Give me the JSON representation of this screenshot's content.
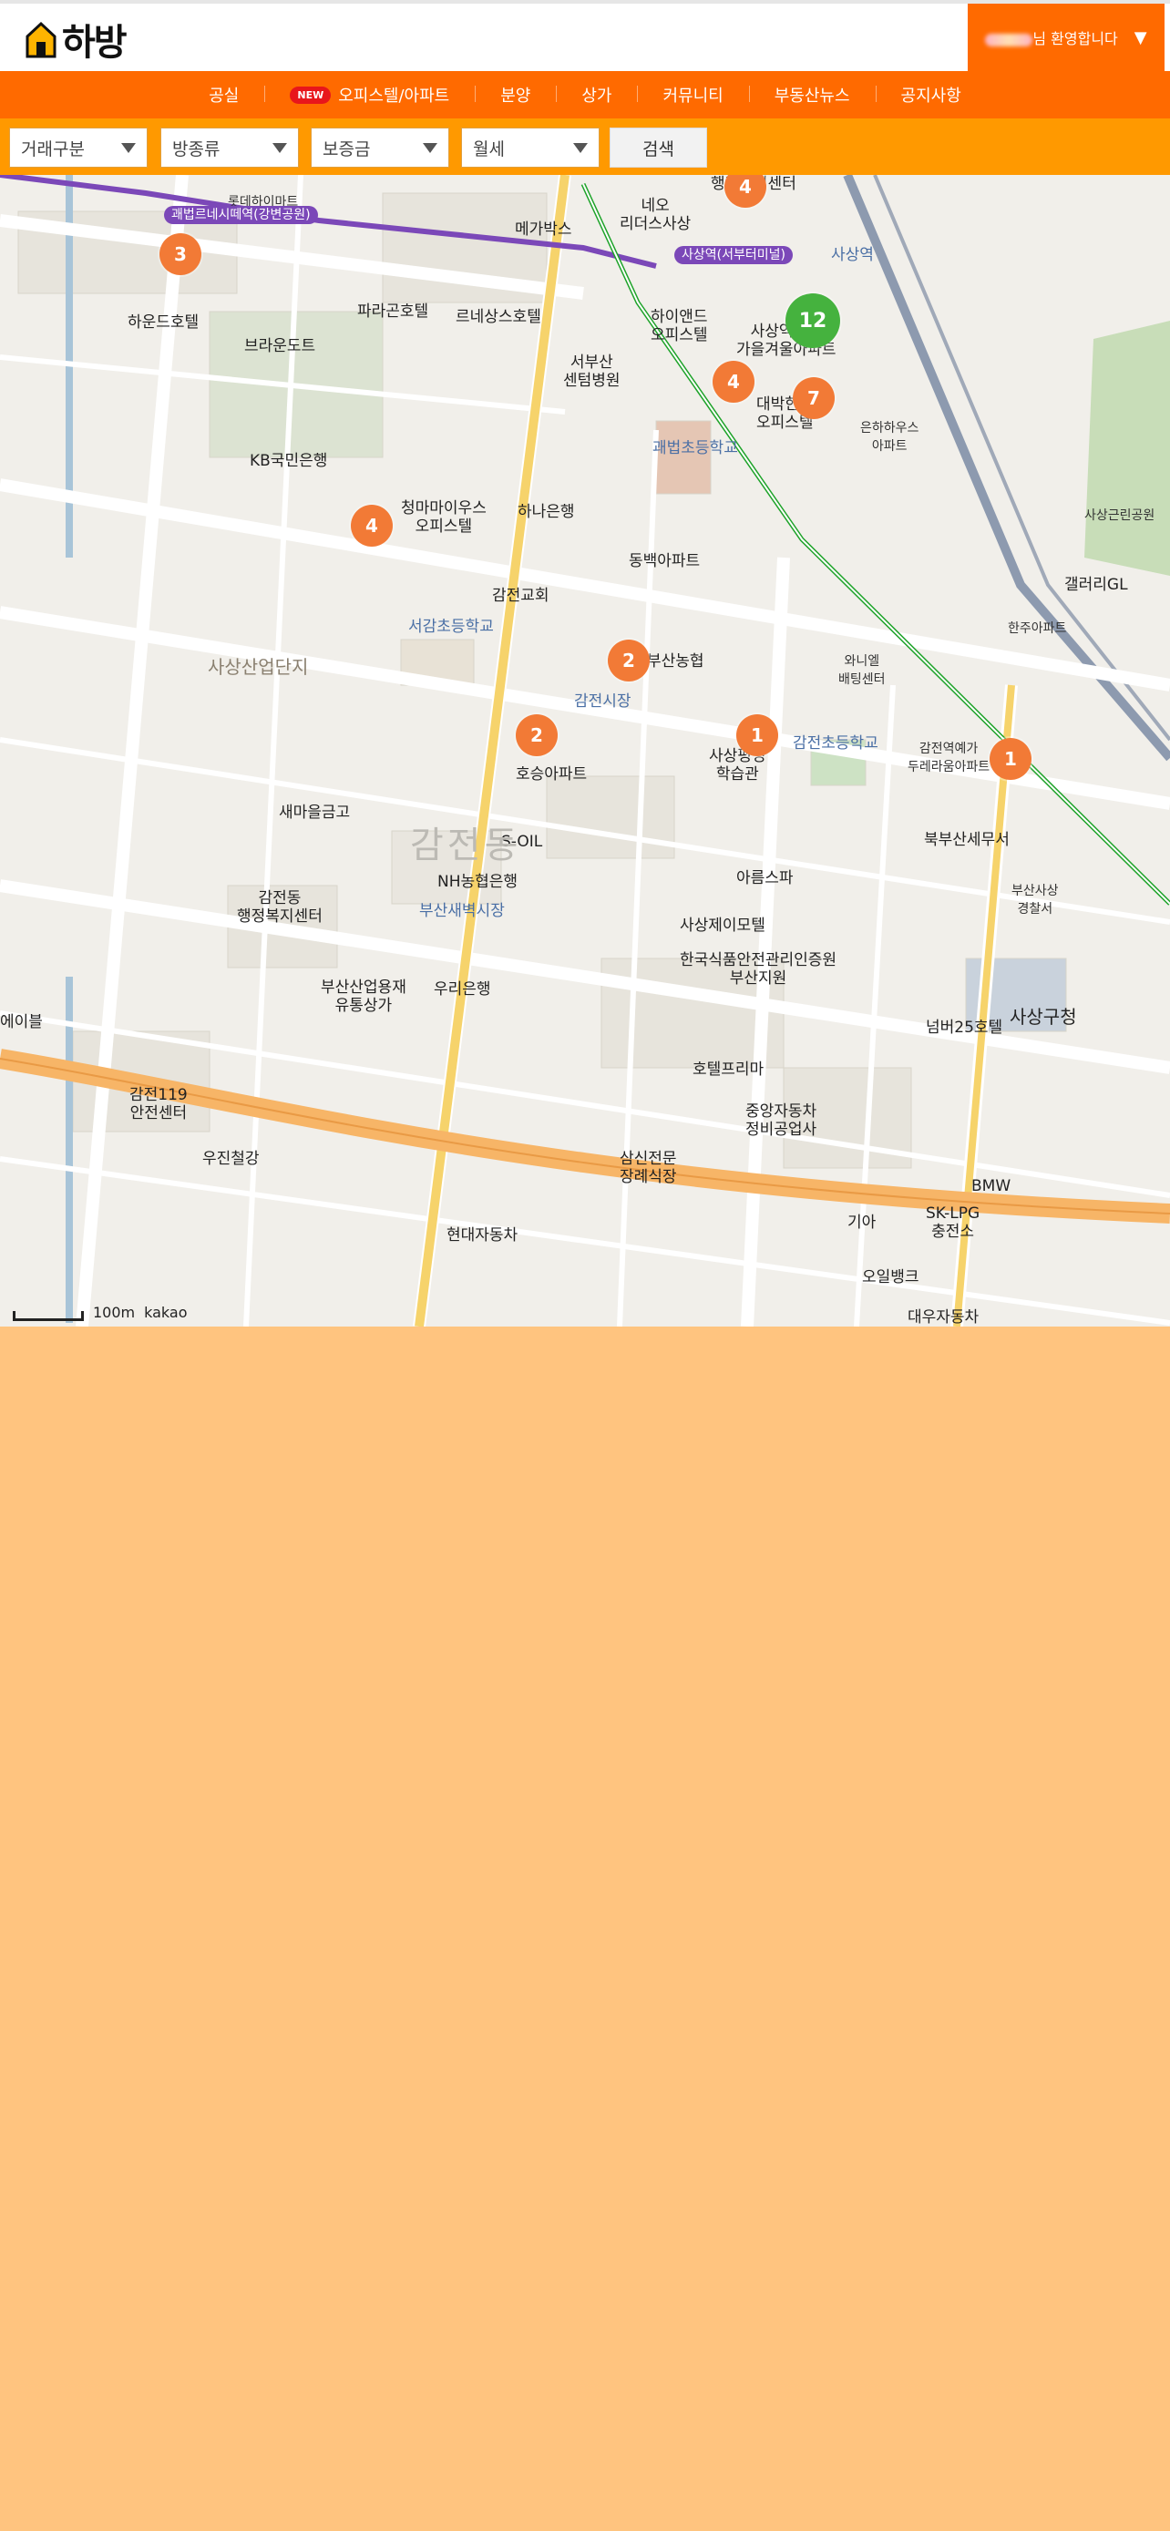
{
  "header": {
    "logo_text": "하방",
    "welcome_suffix": "님 환영합니다",
    "dropdown_icon": "triangle-down-icon"
  },
  "nav": {
    "items": [
      {
        "label": "공실"
      },
      {
        "label": "오피스텔/아파트",
        "badge": "NEW"
      },
      {
        "label": "분양"
      },
      {
        "label": "상가"
      },
      {
        "label": "커뮤니티"
      },
      {
        "label": "부동산뉴스"
      },
      {
        "label": "공지사항"
      }
    ]
  },
  "filters": {
    "deal_type": "거래구분",
    "room_type": "방종류",
    "deposit": "보증금",
    "monthly": "월세",
    "search_label": "검색"
  },
  "map": {
    "clusters": [
      {
        "count": "3"
      },
      {
        "count": "4"
      },
      {
        "count": "4"
      },
      {
        "count": "12"
      },
      {
        "count": "7"
      },
      {
        "count": "2"
      },
      {
        "count": "2"
      },
      {
        "count": "1"
      },
      {
        "count": "1"
      },
      {
        "count": "4"
      }
    ],
    "labels": {
      "l1": "롯데하이마트",
      "l2": "메가박스",
      "l3": "네오\n리더스사상",
      "l4": "행정복지센터",
      "l5": "사상역",
      "l6": "하운드호텔",
      "l7": "파라곤호텔",
      "l8": "르네상스호텔",
      "l9": "브라운도트",
      "l10": "하이앤드\n오피스텔",
      "l11": "사상역대원\n가을겨울아파트",
      "l12": "서부산\n센텀병원",
      "l13": "대박한라\n오피스텔",
      "l14": "은하하우스\n아파트",
      "l15": "괘법초등학교",
      "l16": "KB국민은행",
      "l17": "청마마이우스\n오피스텔",
      "l18": "하나은행",
      "l19": "사상근린공원",
      "l20": "동백아파트",
      "l21": "갤러리GL",
      "l22": "감전교회",
      "l23": "서감초등학교",
      "l24": "한주아파트",
      "l25": "사상산업단지",
      "l26": "부산농협",
      "l27": "와니엘\n배팅센터",
      "l28": "감전시장",
      "l29": "감전초등학교",
      "l30": "감전역예가\n두레라움아파트",
      "l31": "사상평영\n학습관",
      "l32": "호승아파트",
      "l33": "새마을금고",
      "l34": "S-OIL",
      "l35": "북부산세무서",
      "l36": "아름스파",
      "l37": "NH농협은행",
      "l38": "감전동\n행정복지센터",
      "l39": "부산새벽시장",
      "l40": "부산사상\n경찰서",
      "l41": "사상제이모텔",
      "l42": "한국식품안전관리인증원\n부산지원",
      "l43": "부산산업용재\n유통상가",
      "l44": "우리은행",
      "l45": "넘버25호텔",
      "l46": "사상구청",
      "l47": "호텔프리마",
      "l48": "감전119\n안전센터",
      "l49": "중앙자동차\n정비공업사",
      "l50": "우진철강",
      "l51": "삼신전문\n장례식장",
      "l52": "BMW",
      "l53": "기아",
      "l54": "SK-LPG\n충전소",
      "l55": "현대자동차",
      "l56": "오일뱅크",
      "l57": "대우자동차",
      "l58": "에이블",
      "l59": "감전동",
      "l60": "사상역(서부터미널)",
      "l61": "괘법르네시떼역(강변공원)"
    },
    "scale": "100m",
    "provider": "kakao"
  }
}
